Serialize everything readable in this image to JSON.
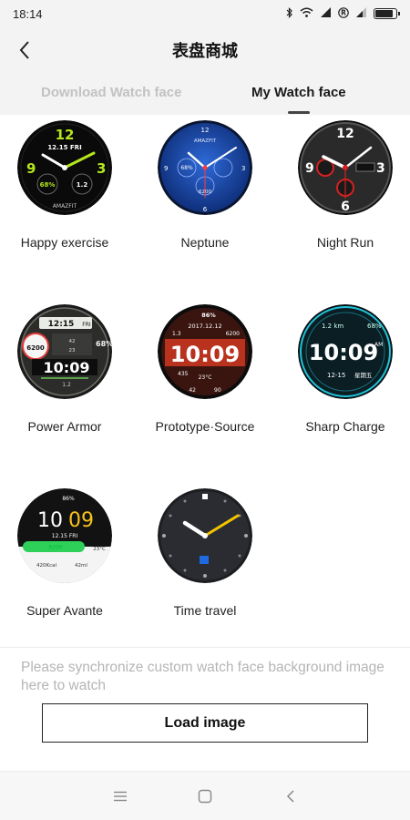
{
  "status_bar": {
    "time": "18:14",
    "icons": [
      "bluetooth-icon",
      "wifi-icon",
      "signal-icon",
      "r-icon",
      "signal-icon-2",
      "battery-icon"
    ],
    "battery_level": 0.85
  },
  "header": {
    "title": "表盘商城",
    "back_icon": "chevron-left-icon"
  },
  "tabs": [
    {
      "label": "Download Watch face",
      "active": false
    },
    {
      "label": "My Watch face",
      "active": true
    }
  ],
  "watch_faces": [
    {
      "name": "Happy exercise",
      "texts": {
        "top": "12",
        "date": "12.15 FRI",
        "left": "9",
        "right": "3",
        "sub_left": "68%",
        "sub_right": "1.2",
        "brand": "AMAZFIT"
      }
    },
    {
      "name": "Neptune",
      "texts": {
        "top": "12",
        "brand": "AMAZFIT",
        "left_dial": "68%",
        "bottom_dial": "6200",
        "left": "9",
        "right": "3",
        "bottom": "6"
      }
    },
    {
      "name": "Night Run",
      "texts": {
        "top": "12",
        "left": "9",
        "right": "3",
        "bottom": "6"
      }
    },
    {
      "name": "Power Armor",
      "texts": {
        "time1": "12:15",
        "day": "FRI",
        "steps": "6200",
        "pct": "68%",
        "time": "10:09",
        "sub": "1.2",
        "v1": "42",
        "v2": "23"
      }
    },
    {
      "name": "Prototype·Source",
      "texts": {
        "battery": "86%",
        "date": "2017.12.12",
        "left": "1.3",
        "right": "6200",
        "time": "10:09",
        "cal": "435",
        "temp": "23°C",
        "b1": "42",
        "b2": "90"
      }
    },
    {
      "name": "Sharp Charge",
      "texts": {
        "km": "1.2 km",
        "pct": "68%",
        "time": "10:09",
        "ampm": "AM",
        "date": "12-15",
        "day": "星期五"
      }
    },
    {
      "name": "Super Avante",
      "texts": {
        "battery": "86%",
        "time_h": "10",
        "time_m": "09",
        "date": "12.15 FRI",
        "bar": "6200",
        "temp": "23°C",
        "kcal": "420Kcal",
        "dist": "42ml"
      }
    },
    {
      "name": "Time travel",
      "texts": {}
    }
  ],
  "sync": {
    "text": "Please synchronize custom watch face background image here to watch",
    "button_label": "Load image"
  },
  "system_nav": {
    "icons": [
      "menu-icon",
      "home-icon",
      "back-icon"
    ]
  },
  "colors": {
    "accent_green": "#b4e61e",
    "neptune_blue": "#1c4fb5",
    "night_red": "#d42020",
    "prototype_red": "#b8321e",
    "sharp_teal": "#23c1d6",
    "avante_yellow": "#f6c21a",
    "avante_green": "#2fd05a",
    "travel_yellow": "#f5c400"
  }
}
